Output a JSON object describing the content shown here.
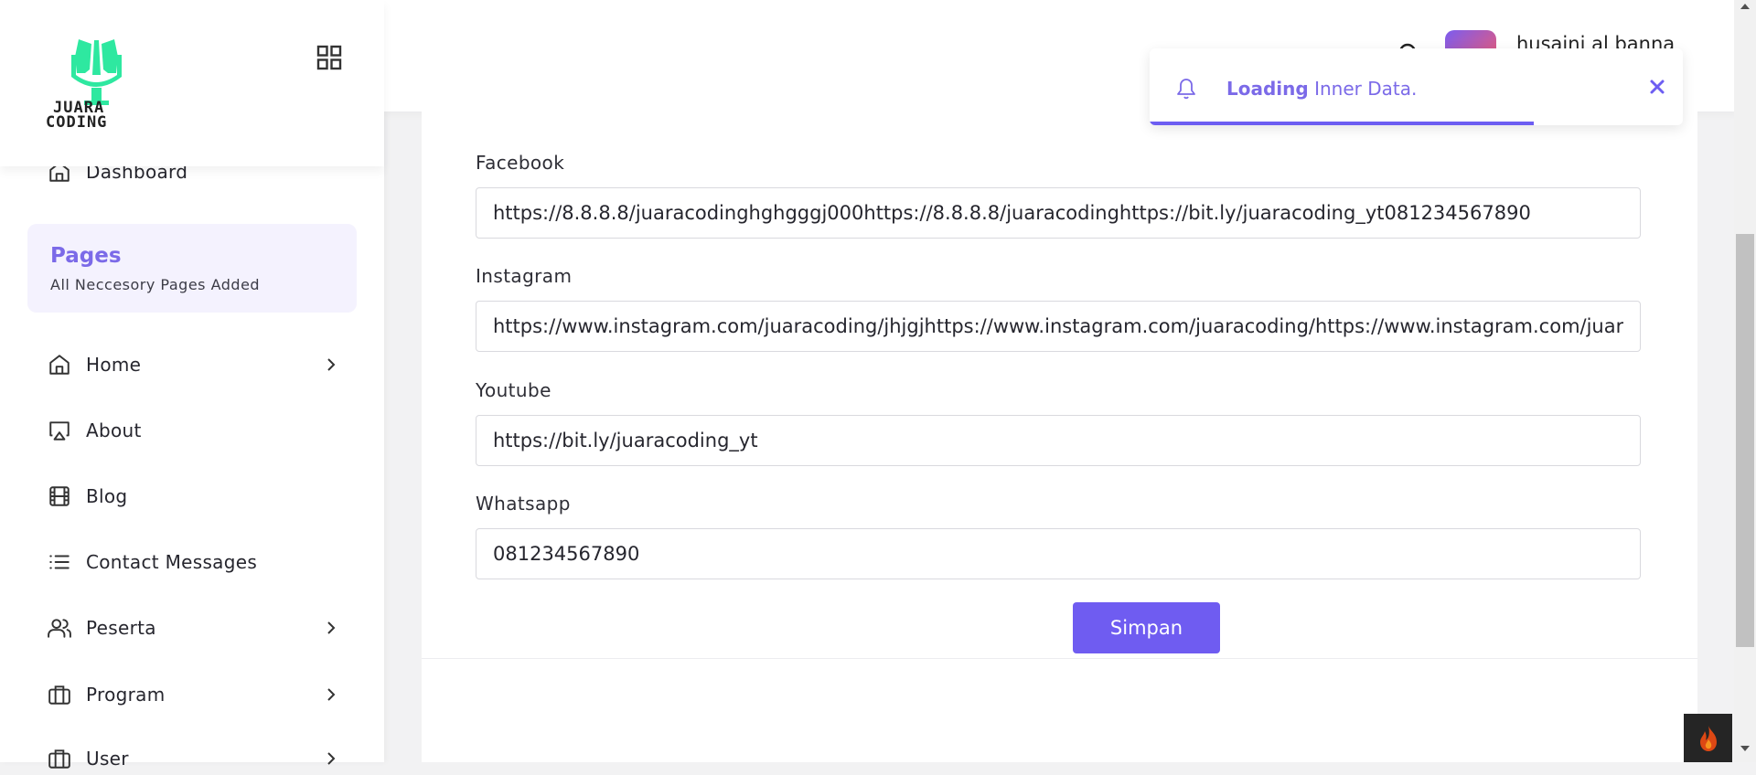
{
  "brand": {
    "logo_text_line1": "JUARA",
    "logo_text_line2": "CODING",
    "logo_color": "#2ee8a0"
  },
  "sidebar": {
    "dashboard_label": "Dashboard",
    "pages_card": {
      "title": "Pages",
      "subtitle": "All Neccesory Pages Added"
    },
    "items": [
      {
        "label": "Home",
        "icon": "home-icon",
        "has_submenu": true
      },
      {
        "label": "About",
        "icon": "airplay-icon",
        "has_submenu": false
      },
      {
        "label": "Blog",
        "icon": "film-icon",
        "has_submenu": false
      },
      {
        "label": "Contact Messages",
        "icon": "list-icon",
        "has_submenu": false
      },
      {
        "label": "Peserta",
        "icon": "users-icon",
        "has_submenu": true
      },
      {
        "label": "Program",
        "icon": "briefcase-icon",
        "has_submenu": true
      },
      {
        "label": "User",
        "icon": "briefcase-icon",
        "has_submenu": true
      }
    ]
  },
  "header": {
    "user_name": "husaini al banna"
  },
  "toast": {
    "bold_text": "Loading",
    "text": " Inner Data.",
    "progress": 0.72
  },
  "form": {
    "fields": [
      {
        "label": "Facebook",
        "value": "https://8.8.8.8/juaracodinghghgggj000https://8.8.8.8/juaracodinghttps://bit.ly/juaracoding_yt081234567890"
      },
      {
        "label": "Instagram",
        "value": "https://www.instagram.com/juaracoding/jhjgjhttps://www.instagram.com/juaracoding/https://www.instagram.com/juaracoding/"
      },
      {
        "label": "Youtube",
        "value": "https://bit.ly/juaracoding_yt"
      },
      {
        "label": "Whatsapp",
        "value": "081234567890"
      }
    ],
    "submit_label": "Simpan"
  },
  "colors": {
    "accent": "#6f5cf1",
    "accent_light": "#f4f2fe",
    "toast_text": "#7b6ae8"
  }
}
